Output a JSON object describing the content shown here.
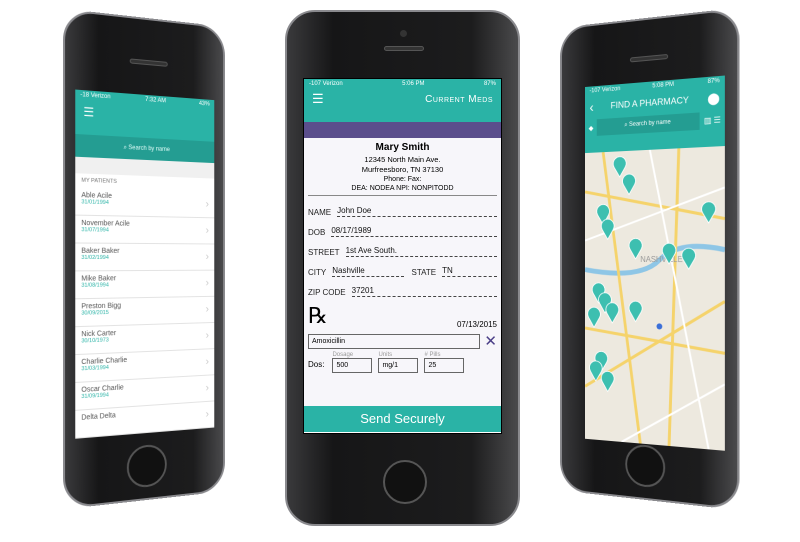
{
  "colors": {
    "teal": "#2ab3a6",
    "purple": "#5b4e8c",
    "pin": "#3dbfb0"
  },
  "left": {
    "status": {
      "carrier": "-18 Verizon",
      "time": "7:32 AM",
      "battery": "43%"
    },
    "search_placeholder": "Search by name",
    "section": "MY PATIENTS",
    "patients": [
      {
        "name": "Able Acile",
        "date": "31/01/1994"
      },
      {
        "name": "November Acile",
        "date": "31/07/1994"
      },
      {
        "name": "Baker Baker",
        "date": "31/02/1994"
      },
      {
        "name": "Mike Baker",
        "date": "31/08/1994"
      },
      {
        "name": "Preston Bigg",
        "date": "30/09/2015"
      },
      {
        "name": "Nick Carter",
        "date": "30/10/1973"
      },
      {
        "name": "Charlie Charlie",
        "date": "31/03/1994"
      },
      {
        "name": "Oscar Charlie",
        "date": "31/09/1994"
      },
      {
        "name": "Delta Delta",
        "date": ""
      }
    ]
  },
  "mid": {
    "status": {
      "carrier": "-107 Verizon",
      "time": "5:06 PM",
      "battery": "87%"
    },
    "title": "Current Meds",
    "doctor": {
      "name": "Mary Smith",
      "address1": "12345 North Main Ave.",
      "address2": "Murfreesboro, TN 37130",
      "phone": "Phone:  Fax:",
      "ids": "DEA: NODEA  NPI: NONPITODD"
    },
    "patient": {
      "name_label": "NAME",
      "name": "John Doe",
      "dob_label": "DOB",
      "dob": "08/17/1989",
      "street_label": "STREET",
      "street": "1st Ave South.",
      "city_label": "CITY",
      "city": "Nashville",
      "state_label": "STATE",
      "state": "TN",
      "zip_label": "ZIP CODE",
      "zip": "37201"
    },
    "rx": {
      "symbol": "℞",
      "date": "07/13/2015",
      "drug": "Amoxicillin",
      "dos_label": "Dos:",
      "dosage_label": "Dosage",
      "dosage": "500",
      "units_label": "Units",
      "units": "mg/1",
      "pills_label": "# Pills",
      "pills": "25"
    },
    "send": "Send Securely"
  },
  "right": {
    "status": {
      "carrier": "-107 Verizon",
      "time": "5:08 PM",
      "battery": "87%"
    },
    "title": "FIND A PHARMACY",
    "search_placeholder": "Search by name",
    "map_label": "NASHVILLE"
  }
}
